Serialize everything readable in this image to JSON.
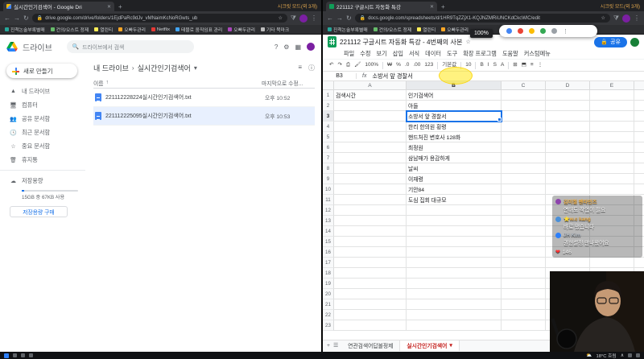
{
  "icons": {
    "back": "←",
    "forward": "→",
    "reload": "↻",
    "search": "🔍",
    "star": "☆",
    "dots": "⋮",
    "lock": "🔒",
    "grid": "▦",
    "gear": "⚙",
    "help": "?",
    "info": "ⓘ",
    "list_view": "≡",
    "undo": "↶",
    "redo": "↷",
    "print": "⎙",
    "paint": "🖌",
    "caret": "▾",
    "chevron": "›",
    "arrow_up": "↑",
    "currency": "₩",
    "percent": "%",
    "dec_dec": ".0",
    "dec_inc": ".00",
    "bold": "B",
    "italic": "I",
    "strike": "S",
    "text_color": "A",
    "borders": "⊞",
    "merge": "⬒",
    "align": "≡",
    "plus": "+",
    "menu": "☰",
    "close": "✕",
    "fx": "fx",
    "heart": "❤",
    "comment": "🗨",
    "up_caret": "∧",
    "weather": "⛅",
    "puzzle": "⧩"
  },
  "left_window": {
    "tab_title": "실시간인기검색어 - Google Dri",
    "profile_chip": "시크릿 모드(외 3개)",
    "url": "drive.google.com/drive/folders/1EjdPaRc9dJv_vMNaimKcNoRGwts_ub",
    "bookmarks": [
      "진척논술부록별매",
      "건의/오스트 정제",
      "열린티",
      "오빠두관리",
      "Netflix",
      "테블로 움직임표 관리",
      "오빠두관리",
      "기타 북마크"
    ],
    "drive": {
      "app_name": "드라이브",
      "search_placeholder": "드라이브에서 검색",
      "breadcrumb": {
        "root": "내 드라이브",
        "current": "실시간인기검색어"
      },
      "new_button_label": "새로 만들기",
      "nav_items": [
        {
          "icon": "▲",
          "label": "내 드라이브"
        },
        {
          "icon": "🖥",
          "label": "컴퓨터"
        },
        {
          "icon": "👥",
          "label": "공유 문서함"
        },
        {
          "icon": "🕓",
          "label": "최근 문서함"
        },
        {
          "icon": "☆",
          "label": "중요 문서함"
        },
        {
          "icon": "🗑",
          "label": "휴지통"
        }
      ],
      "storage_icon": "☁",
      "storage_label": "저장용량",
      "storage_usage": "15GB 중 67KB 사용",
      "buy_storage_label": "저장용량 구매",
      "list": {
        "name_header": "이름",
        "modified_header": "마지막으로 수정...",
        "files": [
          {
            "name": "221112228224실시간인기검색어.txt",
            "modified": "오후 10:52",
            "selected": false
          },
          {
            "name": "221112225095실시간인기검색어.txt",
            "modified": "오후 10:53",
            "selected": true
          }
        ]
      }
    }
  },
  "right_window": {
    "tab_title": "221112 구글시트 자동화 특강",
    "profile_chip": "시크릿 모드(외 3개)",
    "url": "docs.google.com/spreadsheets/d/1HR9TqZZjX1-KQJNZMRiUNCKdCkcWlC/edit",
    "bookmarks": [
      "진척논술부록별매",
      "건의/오스트 정제",
      "열린티",
      "오빠두관리"
    ],
    "zoom_tooltip": "100%",
    "sheets": {
      "title": "221112 구글시트 자동화 특강 - 4번째의 사본",
      "menus": [
        "파일",
        "수정",
        "보기",
        "삽입",
        "서식",
        "데이터",
        "도구",
        "확장 프로그램",
        "도움말",
        "커스텀메뉴"
      ],
      "share_label": "공유",
      "toolbar": {
        "zoom": "100%",
        "format": "123",
        "font": "기본값",
        "size": "10"
      },
      "name_box": "B3",
      "formula_value": "소방서 앞 경찰서",
      "grid": {
        "columns": [
          "A",
          "B",
          "C",
          "D",
          "E",
          "F"
        ],
        "total_rows": 23,
        "selected": {
          "row": 3,
          "col": "B"
        },
        "rows": [
          {
            "n": "1",
            "A": "검색시간",
            "B": "인기검색어"
          },
          {
            "n": "2",
            "B": "아들"
          },
          {
            "n": "3",
            "B": "소방서 앞 경찰서"
          },
          {
            "n": "4",
            "B": "한리 한의원 횡령"
          },
          {
            "n": "5",
            "B": "핸드처진 변호사 128화"
          },
          {
            "n": "6",
            "B": "최정원"
          },
          {
            "n": "7",
            "B": "삼남매가 용감하게"
          },
          {
            "n": "8",
            "B": "날씨"
          },
          {
            "n": "9",
            "B": "이재령"
          },
          {
            "n": "10",
            "B": "기안84"
          },
          {
            "n": "11",
            "B": "도심 집회 대규모"
          }
        ]
      },
      "sheet_tabs": [
        {
          "label": "연관검색어답볼정제",
          "active": false
        },
        {
          "label": "실시간인기검색어",
          "active": true
        }
      ]
    }
  },
  "chat_overlay": {
    "messages": [
      {
        "name": "김미철 펜타민즈",
        "name_color": "#f1b24a",
        "avatar_color": "#8e44ad",
        "text": "연대도 작업이 필요"
      },
      {
        "name": "⭐w.c kang",
        "name_color": "#f1b24a",
        "avatar_color": "#4a90d9",
        "text": "바로 됐습니다"
      },
      {
        "name": "JH Kim",
        "name_color": "#aeb6bf",
        "avatar_color": "#2d7ff9",
        "text": "권현설정 만나왔어요"
      }
    ],
    "likes": "146"
  },
  "taskbar": {
    "weather": "18°C 흐림"
  }
}
